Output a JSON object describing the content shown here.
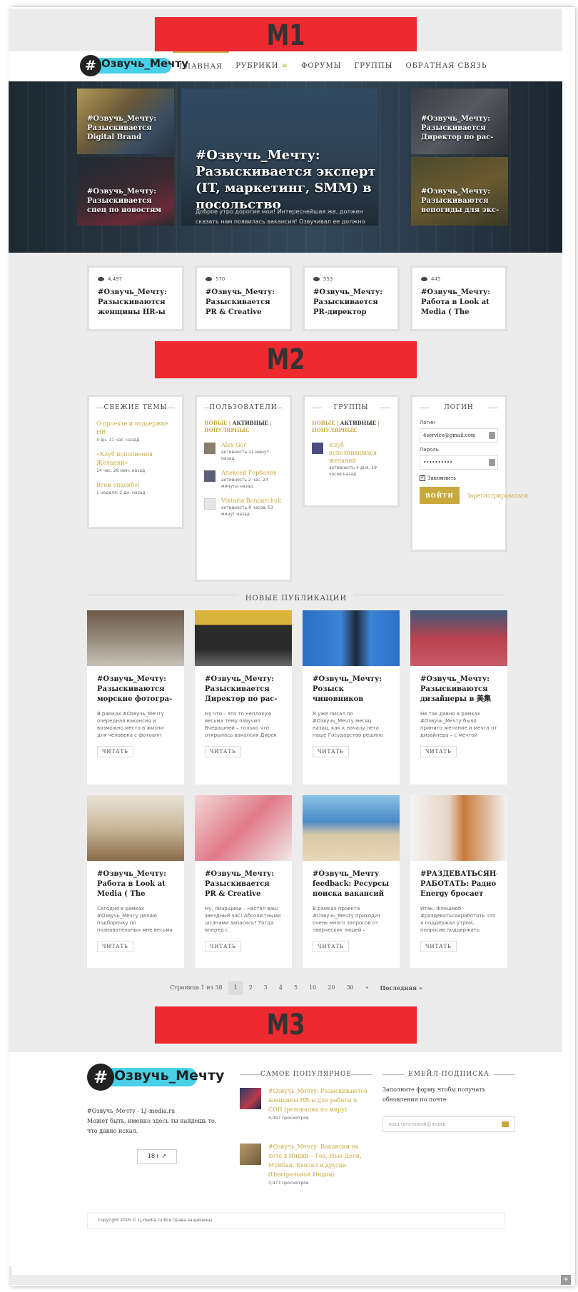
{
  "banners": {
    "m1": "M1",
    "m2": "M2",
    "m3": "M3"
  },
  "logo": {
    "hash": "#",
    "text": "Озвучь_Мечту"
  },
  "nav": [
    {
      "label": "ГЛАВНАЯ"
    },
    {
      "label": "РУБРИКИ",
      "icon": "menu-icon"
    },
    {
      "label": "ФОРУМЫ"
    },
    {
      "label": "ГРУППЫ"
    },
    {
      "label": "ОБРАТНАЯ СВЯЗЬ"
    }
  ],
  "hero": {
    "tiles": [
      {
        "title": "#Озвучь_Мечту: Разыскивается Digital Brand"
      },
      {
        "title": "#Озвучь_Мечту: Разыскивается спец по новостям"
      },
      {
        "title": "#Озвучь_Мечту: Разыскивается Директор по рас-"
      },
      {
        "title": "#Озвучь_Мечту: Разыскиваются вепогиды для экс-"
      }
    ],
    "main_title": "#Озвучь_Мечту: Разыскивается эксперт (IT, маркетинг, SMM) в посольство",
    "main_text": "Доброе утро дорогие мои! Интереснейшая же, должен сказать нам появилась вакансия! Озвучивал ее должно"
  },
  "popular_cards": [
    {
      "views": "4,497",
      "title": "#Озвучь_Мечту: Разыскиваются женщины HR-ы"
    },
    {
      "views": "570",
      "title": "#Озвучь_Мечту: Разыскивается PR & Creative Assistant"
    },
    {
      "views": "553",
      "title": "#Озвучь_Мечту: Разыскивается PR-директор аэро-"
    },
    {
      "views": "445",
      "title": "#Озвучь_Мечту: Работа в Look at Media ( The Village,"
    }
  ],
  "widgets": {
    "fresh": {
      "title": "СВЕЖИЕ ТЕМЫ",
      "items": [
        {
          "title": "О проекте и поддержке HR",
          "meta": "3 дн. 11 час. назад"
        },
        {
          "title": "«Клуб исполнения Желаний»",
          "meta": "14 час. 28 мин. назад"
        },
        {
          "title": "Всем спасибо!",
          "meta": "1 неделя, 2 дн. назад"
        }
      ]
    },
    "users": {
      "title": "ПОЛЬЗОВАТЕЛИ",
      "tab_new": "НОВЫЕ",
      "sep": " | ",
      "tab_active": "АКТИВНЫЕ",
      "tab_popular": "ПОПУЛЯРНЫЕ",
      "list": [
        {
          "name": "Alex Gor",
          "meta": "активность 11 минут назад"
        },
        {
          "name": "Алексей Горбачёв",
          "meta": "активность 2 час, 24 минуты назад"
        },
        {
          "name": "Viktoria Bondarchuk",
          "meta": "активность 8 часов, 53 минут назад"
        }
      ]
    },
    "groups": {
      "title": "ГРУППЫ",
      "tab_new": "НОВЫЕ",
      "sep": " | ",
      "tab_active": "АКТИВНЫЕ",
      "tab_popular": "ПОПУЛЯРНЫЕ",
      "list": [
        {
          "name": "Клуб исполнившихся желаний",
          "meta": "активность 4 дня, 19 часов назад"
        }
      ]
    },
    "login": {
      "title": "ЛОГИН",
      "login_label": "Логин",
      "login_value": "4service@gmail.com",
      "password_label": "Пароль",
      "password_value": "••••••••••",
      "remember": "Запомнить",
      "button": "ВОЙТИ",
      "register": "Зарегистрироваться"
    }
  },
  "publications": {
    "title": "НОВЫЕ ПУБЛИКАЦИИ",
    "read": "ЧИТАТЬ",
    "items": [
      {
        "title": "#Озвучь_Мечту: Разыскиваются морские фотогра-",
        "excerpt": "В рамках #Озвучь_Мечту очередная вакансия и возможно место в жизни для человека с фотоапп"
      },
      {
        "title": "#Озвучь_Мечту: Разыскивается Директор по рас-",
        "excerpt": "Ну что – это то неплохую весьма тему озвучил Вчерашней – только что открылась вакансия Дирек"
      },
      {
        "title": "#Озвучь_Мечту: Розыск чиновников умеющих мо-",
        "excerpt": "Я уже писал по #Озвучь_Мечту месяц назад, как к началу лета наше Государство решило"
      },
      {
        "title": "#Озвучь_Мечту: Разыскиваются дизайнеры в 美集",
        "excerpt": "Не так давно в рамках #Озвучь_Мечту было принято желание и мечта от дизайнера – с мечтой"
      },
      {
        "title": "#Озвучь_Мечту: Работа в Look at Media ( The Village,",
        "excerpt": "Сегодня в рамках #Озвучь_Мечту делаю подборочку по познавательных мне весьма крутых"
      },
      {
        "title": "#Озвучь_Мечту: Разыскивается PR & Creative Assistant",
        "excerpt": "Ну, пиарщики – настал ваш звездный час! Абсолютными штанами запасись? Тогда вперед с"
      },
      {
        "title": "#Озвучь_Мечту feedback: Ресурсы поиска вакансий",
        "excerpt": "В рамках проекта #Озвучь_Мечту приходит очень много запросов от творческих людей –"
      },
      {
        "title": "#РАЗДЕВАТЬСЯН-РАБОТАТЬ: Радио Energy бросает вы-",
        "excerpt": "Итак. Флешмоб #раздеватьсяиработать что я поддержал утром, попросив поддержать бухгалтер"
      }
    ]
  },
  "pagination": {
    "info": "Страница 1 из 38",
    "pages": [
      "1",
      "2",
      "3",
      "4",
      "5",
      "10",
      "20",
      "30"
    ],
    "next_arrow": "»",
    "last": "Последняя »"
  },
  "footer": {
    "text_line1": "#Озвучь_Мечту - LJ-media.ru",
    "text_line2": "Может быть, именно здесь ты найдешь то, что давно искал.",
    "badge": "18+ ↗",
    "popular_title": "САМОЕ ПОПУЛЯРНОЕ",
    "popular": [
      {
        "title": "#Озвучь_Мечту: Разыскиваются женщины HR-ы для работы в СОН (релокация по миру)",
        "views": "4,497 просмотров"
      },
      {
        "title": "#Озвучь_Мечту: Вакансии на лето в Индии – Гоа, Нью-Дели, Мумбаи, Бхопал и другие (Центральной Индии)",
        "views": "3,477 просмотров"
      }
    ],
    "sub_title": "ЕМЕЙЛ-ПОДПИСКА",
    "sub_text": "Заполните форму чтобы получать обновления по почте",
    "sub_placeholder": "ваш почтовый@ящик",
    "copyright": "Copyright 2016 © LJ-media.ru Все права защищены"
  },
  "colors": {
    "accent": "#c9a93c",
    "banner": "#ec2a2f",
    "logo_bg": "#49cfe6"
  }
}
